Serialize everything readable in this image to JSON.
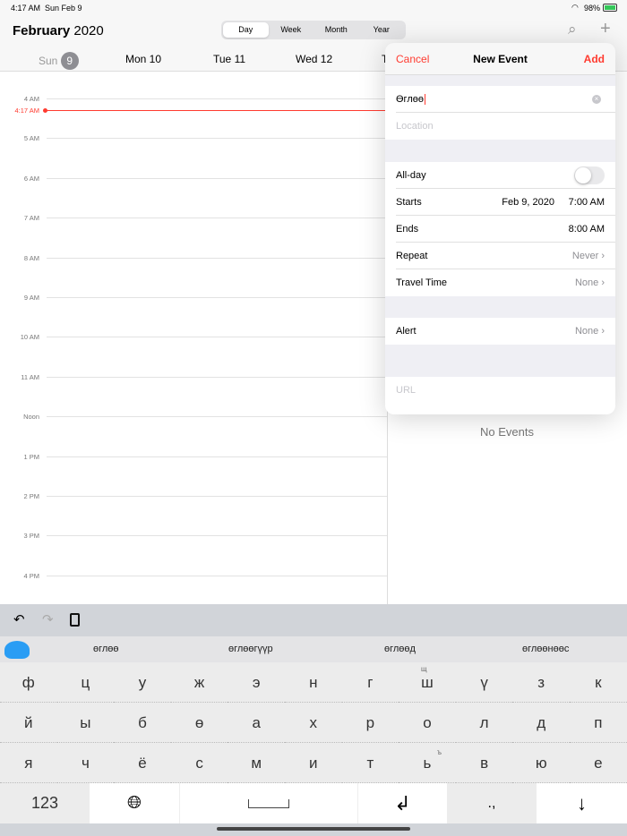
{
  "status": {
    "time": "4:17 AM",
    "date": "Sun Feb 9",
    "battery": "98%"
  },
  "header": {
    "month": "February",
    "year": "2020",
    "views": [
      "Day",
      "Week",
      "Month",
      "Year"
    ],
    "days": [
      "Sun",
      "9",
      "Mon 10",
      "Tue 11",
      "Wed 12",
      "T"
    ]
  },
  "timeline": {
    "hours": [
      "4 AM",
      "5 AM",
      "6 AM",
      "7 AM",
      "8 AM",
      "9 AM",
      "10 AM",
      "11 AM",
      "Noon",
      "1 PM",
      "2 PM",
      "3 PM",
      "4 PM"
    ],
    "now": "4:17 AM"
  },
  "no_events": "No Events",
  "popover": {
    "cancel": "Cancel",
    "title": "New Event",
    "add": "Add",
    "event_title": "Өглөө",
    "location_placeholder": "Location",
    "allday": "All-day",
    "starts": "Starts",
    "starts_date": "Feb 9, 2020",
    "starts_time": "7:00 AM",
    "ends": "Ends",
    "ends_time": "8:00 AM",
    "repeat": "Repeat",
    "repeat_val": "Never",
    "travel": "Travel Time",
    "travel_val": "None",
    "alert": "Alert",
    "alert_val": "None",
    "url_placeholder": "URL"
  },
  "keyboard": {
    "suggestions": [
      "өглөө",
      "өглөөгүүр",
      "өглөөд",
      "өглөөнөөс"
    ],
    "rows": [
      [
        "ф",
        "ц",
        "у",
        "ж",
        "э",
        "н",
        "г",
        "ш",
        "ү",
        "з",
        "к"
      ],
      [
        "й",
        "ы",
        "б",
        "ө",
        "а",
        "х",
        "р",
        "о",
        "л",
        "д",
        "п"
      ],
      [
        "я",
        "ч",
        "ё",
        "с",
        "м",
        "и",
        "т",
        "ь",
        "в",
        "ю",
        "е"
      ]
    ],
    "alt_sh": "щ",
    "alt_soft": "ъ",
    "numbers": "123",
    "punct": ".,"
  },
  "colors": {
    "accent": "#ff3b30"
  }
}
